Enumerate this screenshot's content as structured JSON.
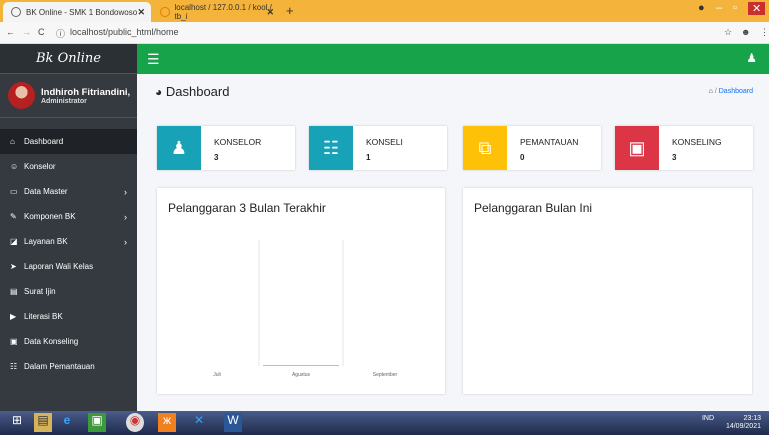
{
  "browser": {
    "tab_active": "BK Online - SMK 1 Bondowoso",
    "tab_inactive": "localhost / 127.0.0.1 / kool / tb_i",
    "close": "✕",
    "new_tab": "+",
    "url": "localhost/public_html/home"
  },
  "sidebar": {
    "brand": "Bk Online",
    "user_name": "Indhiroh Fitriandini,",
    "user_role": "Administrator",
    "items": [
      {
        "label": "Dashboard",
        "icon": "home-icon",
        "glyph": "⌂",
        "active": true,
        "arrow": false
      },
      {
        "label": "Konselor",
        "icon": "user-outline-icon",
        "glyph": "☺",
        "arrow": false
      },
      {
        "label": "Data Master",
        "icon": "laptop-icon",
        "glyph": "▭",
        "arrow": true
      },
      {
        "label": "Komponen BK",
        "icon": "edit-icon",
        "glyph": "✎",
        "arrow": true
      },
      {
        "label": "Layanan BK",
        "icon": "book-icon",
        "glyph": "◪",
        "arrow": true
      },
      {
        "label": "Laporan Wali Kelas",
        "icon": "send-icon",
        "glyph": "➤",
        "arrow": false
      },
      {
        "label": "Surat Ijin",
        "icon": "file-icon",
        "glyph": "▤",
        "arrow": false
      },
      {
        "label": "Literasi BK",
        "icon": "video-icon",
        "glyph": "▶",
        "arrow": false
      },
      {
        "label": "Data Konseling",
        "icon": "briefcase-icon",
        "glyph": "▣",
        "arrow": false
      },
      {
        "label": "Dalam Pemantauan",
        "icon": "users-icon",
        "glyph": "☷",
        "arrow": false
      }
    ],
    "arrow": "›"
  },
  "header": {
    "menu_icon": "☰",
    "user_icon": "♟"
  },
  "page": {
    "title": "Dashboard",
    "breadcrumb_home": "⌂",
    "breadcrumb_sep": " / ",
    "breadcrumb_current": "Dashboard"
  },
  "stats": [
    {
      "label": "KONSELOR",
      "value": "3",
      "color": "#17a2b8",
      "icon": "user-icon",
      "glyph": "♟"
    },
    {
      "label": "KONSELI",
      "value": "1",
      "color": "#17a2b8",
      "icon": "users-icon",
      "glyph": "☷"
    },
    {
      "label": "PEMANTAUAN",
      "value": "0",
      "color": "#ffc107",
      "icon": "copy-icon",
      "glyph": "⧉"
    },
    {
      "label": "KONSELING",
      "value": "3",
      "color": "#dc3545",
      "icon": "briefcase-icon",
      "glyph": "▣"
    }
  ],
  "cards": {
    "left_title": "Pelanggaran 3 Bulan Terakhir",
    "right_title": "Pelanggaran Bulan Ini"
  },
  "chart_data": {
    "type": "bar",
    "categories": [
      "Juli",
      "Agustus",
      "September"
    ],
    "values": [
      0,
      0,
      0
    ],
    "title": "Pelanggaran 3 Bulan Terakhir",
    "xlabel": "",
    "ylabel": "",
    "grid": true
  },
  "tray": {
    "lang": "IND",
    "time": "23:13",
    "date": "14/09/2021"
  }
}
